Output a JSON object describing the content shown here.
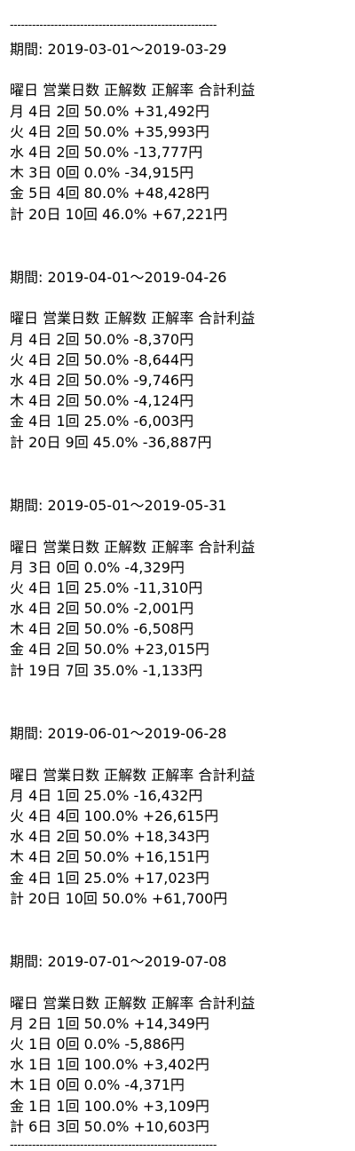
{
  "divider": "--------------------------------------------------------",
  "period_label": "期間: ",
  "range_sep": "～",
  "header": "曜日 営業日数 正解数 正解率 合計利益",
  "sections": [
    {
      "start": "2019-03-01",
      "end": "2019-03-29",
      "rows": [
        "月 4日 2回 50.0% +31,492円",
        "火 4日 2回 50.0% +35,993円",
        "水 4日 2回 50.0% -13,777円",
        "木 3日 0回 0.0% -34,915円",
        "金 5日 4回 80.0% +48,428円",
        "計 20日 10回 46.0% +67,221円"
      ]
    },
    {
      "start": "2019-04-01",
      "end": "2019-04-26",
      "rows": [
        "月 4日 2回 50.0% -8,370円",
        "火 4日 2回 50.0% -8,644円",
        "水 4日 2回 50.0% -9,746円",
        "木 4日 2回 50.0% -4,124円",
        "金 4日 1回 25.0% -6,003円",
        "計 20日 9回 45.0% -36,887円"
      ]
    },
    {
      "start": "2019-05-01",
      "end": "2019-05-31",
      "rows": [
        "月 3日 0回 0.0% -4,329円",
        "火 4日 1回 25.0% -11,310円",
        "水 4日 2回 50.0% -2,001円",
        "木 4日 2回 50.0% -6,508円",
        "金 4日 2回 50.0% +23,015円",
        "計 19日 7回 35.0% -1,133円"
      ]
    },
    {
      "start": "2019-06-01",
      "end": "2019-06-28",
      "rows": [
        "月 4日 1回 25.0% -16,432円",
        "火 4日 4回 100.0% +26,615円",
        "水 4日 2回 50.0% +18,343円",
        "木 4日 2回 50.0% +16,151円",
        "金 4日 1回 25.0% +17,023円",
        "計 20日 10回 50.0% +61,700円"
      ]
    },
    {
      "start": "2019-07-01",
      "end": "2019-07-08",
      "rows": [
        "月 2日 1回 50.0% +14,349円",
        "火 1日 0回 0.0% -5,886円",
        "水 1日 1回 100.0% +3,402円",
        "木 1日 0回 0.0% -4,371円",
        "金 1日 1回 100.0% +3,109円",
        "計 6日 3回 50.0% +10,603円"
      ]
    }
  ]
}
